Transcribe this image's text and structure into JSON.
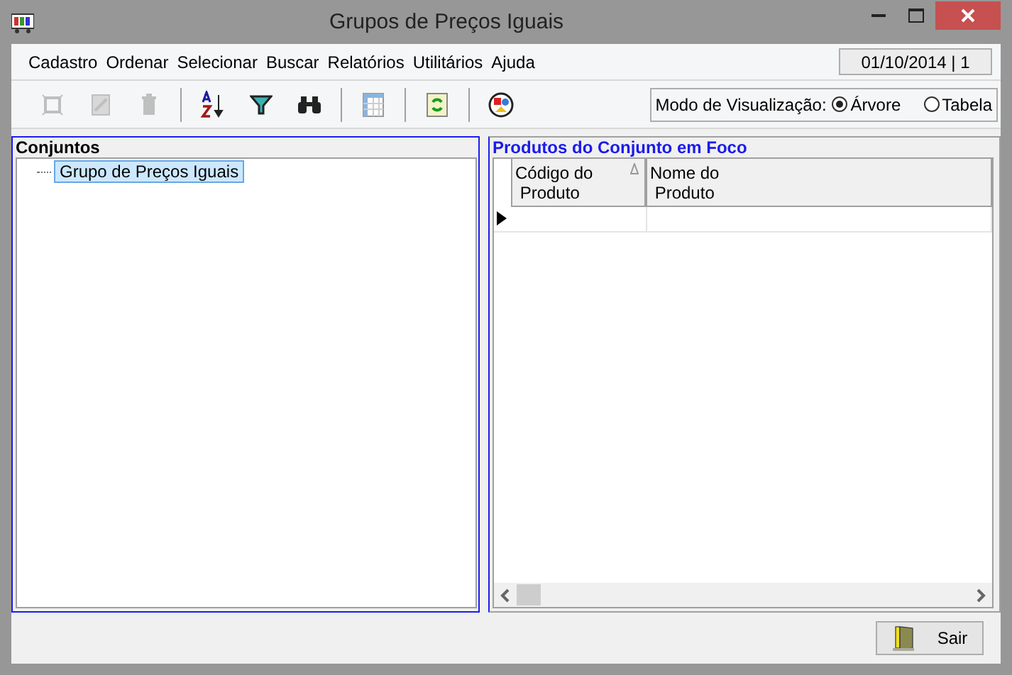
{
  "window": {
    "title": "Grupos de Preços Iguais"
  },
  "menu": [
    "Cadastro",
    "Ordenar",
    "Selecionar",
    "Buscar",
    "Relatórios",
    "Utilitários",
    "Ajuda"
  ],
  "date_field": "01/10/2014 | 1",
  "toolbar": [
    {
      "kind": "new",
      "disabled": true
    },
    {
      "kind": "edit",
      "disabled": true
    },
    {
      "kind": "delete",
      "disabled": true
    },
    {
      "kind": "sep"
    },
    {
      "kind": "sort",
      "disabled": false
    },
    {
      "kind": "filter",
      "disabled": false
    },
    {
      "kind": "find",
      "disabled": false
    },
    {
      "kind": "sep"
    },
    {
      "kind": "columns",
      "disabled": false
    },
    {
      "kind": "sep"
    },
    {
      "kind": "refresh",
      "disabled": false
    },
    {
      "kind": "sep"
    },
    {
      "kind": "report",
      "disabled": false
    }
  ],
  "view_mode": {
    "label": "Modo de Visualização:",
    "options": [
      {
        "label": "Árvore",
        "selected": true
      },
      {
        "label": "Tabela",
        "selected": false
      }
    ]
  },
  "sets_panel": {
    "title": "Conjuntos",
    "tree": [
      {
        "label": "Grupo de Preços Iguais",
        "selected": true
      }
    ]
  },
  "products_panel": {
    "title": "Produtos do Conjunto em Foco",
    "columns": [
      {
        "label": "Código do\n Produto",
        "sorted": true
      },
      {
        "label": "Nome do\n Produto",
        "sorted": false
      }
    ]
  },
  "buttons": [
    {
      "label": "Sair"
    }
  ]
}
